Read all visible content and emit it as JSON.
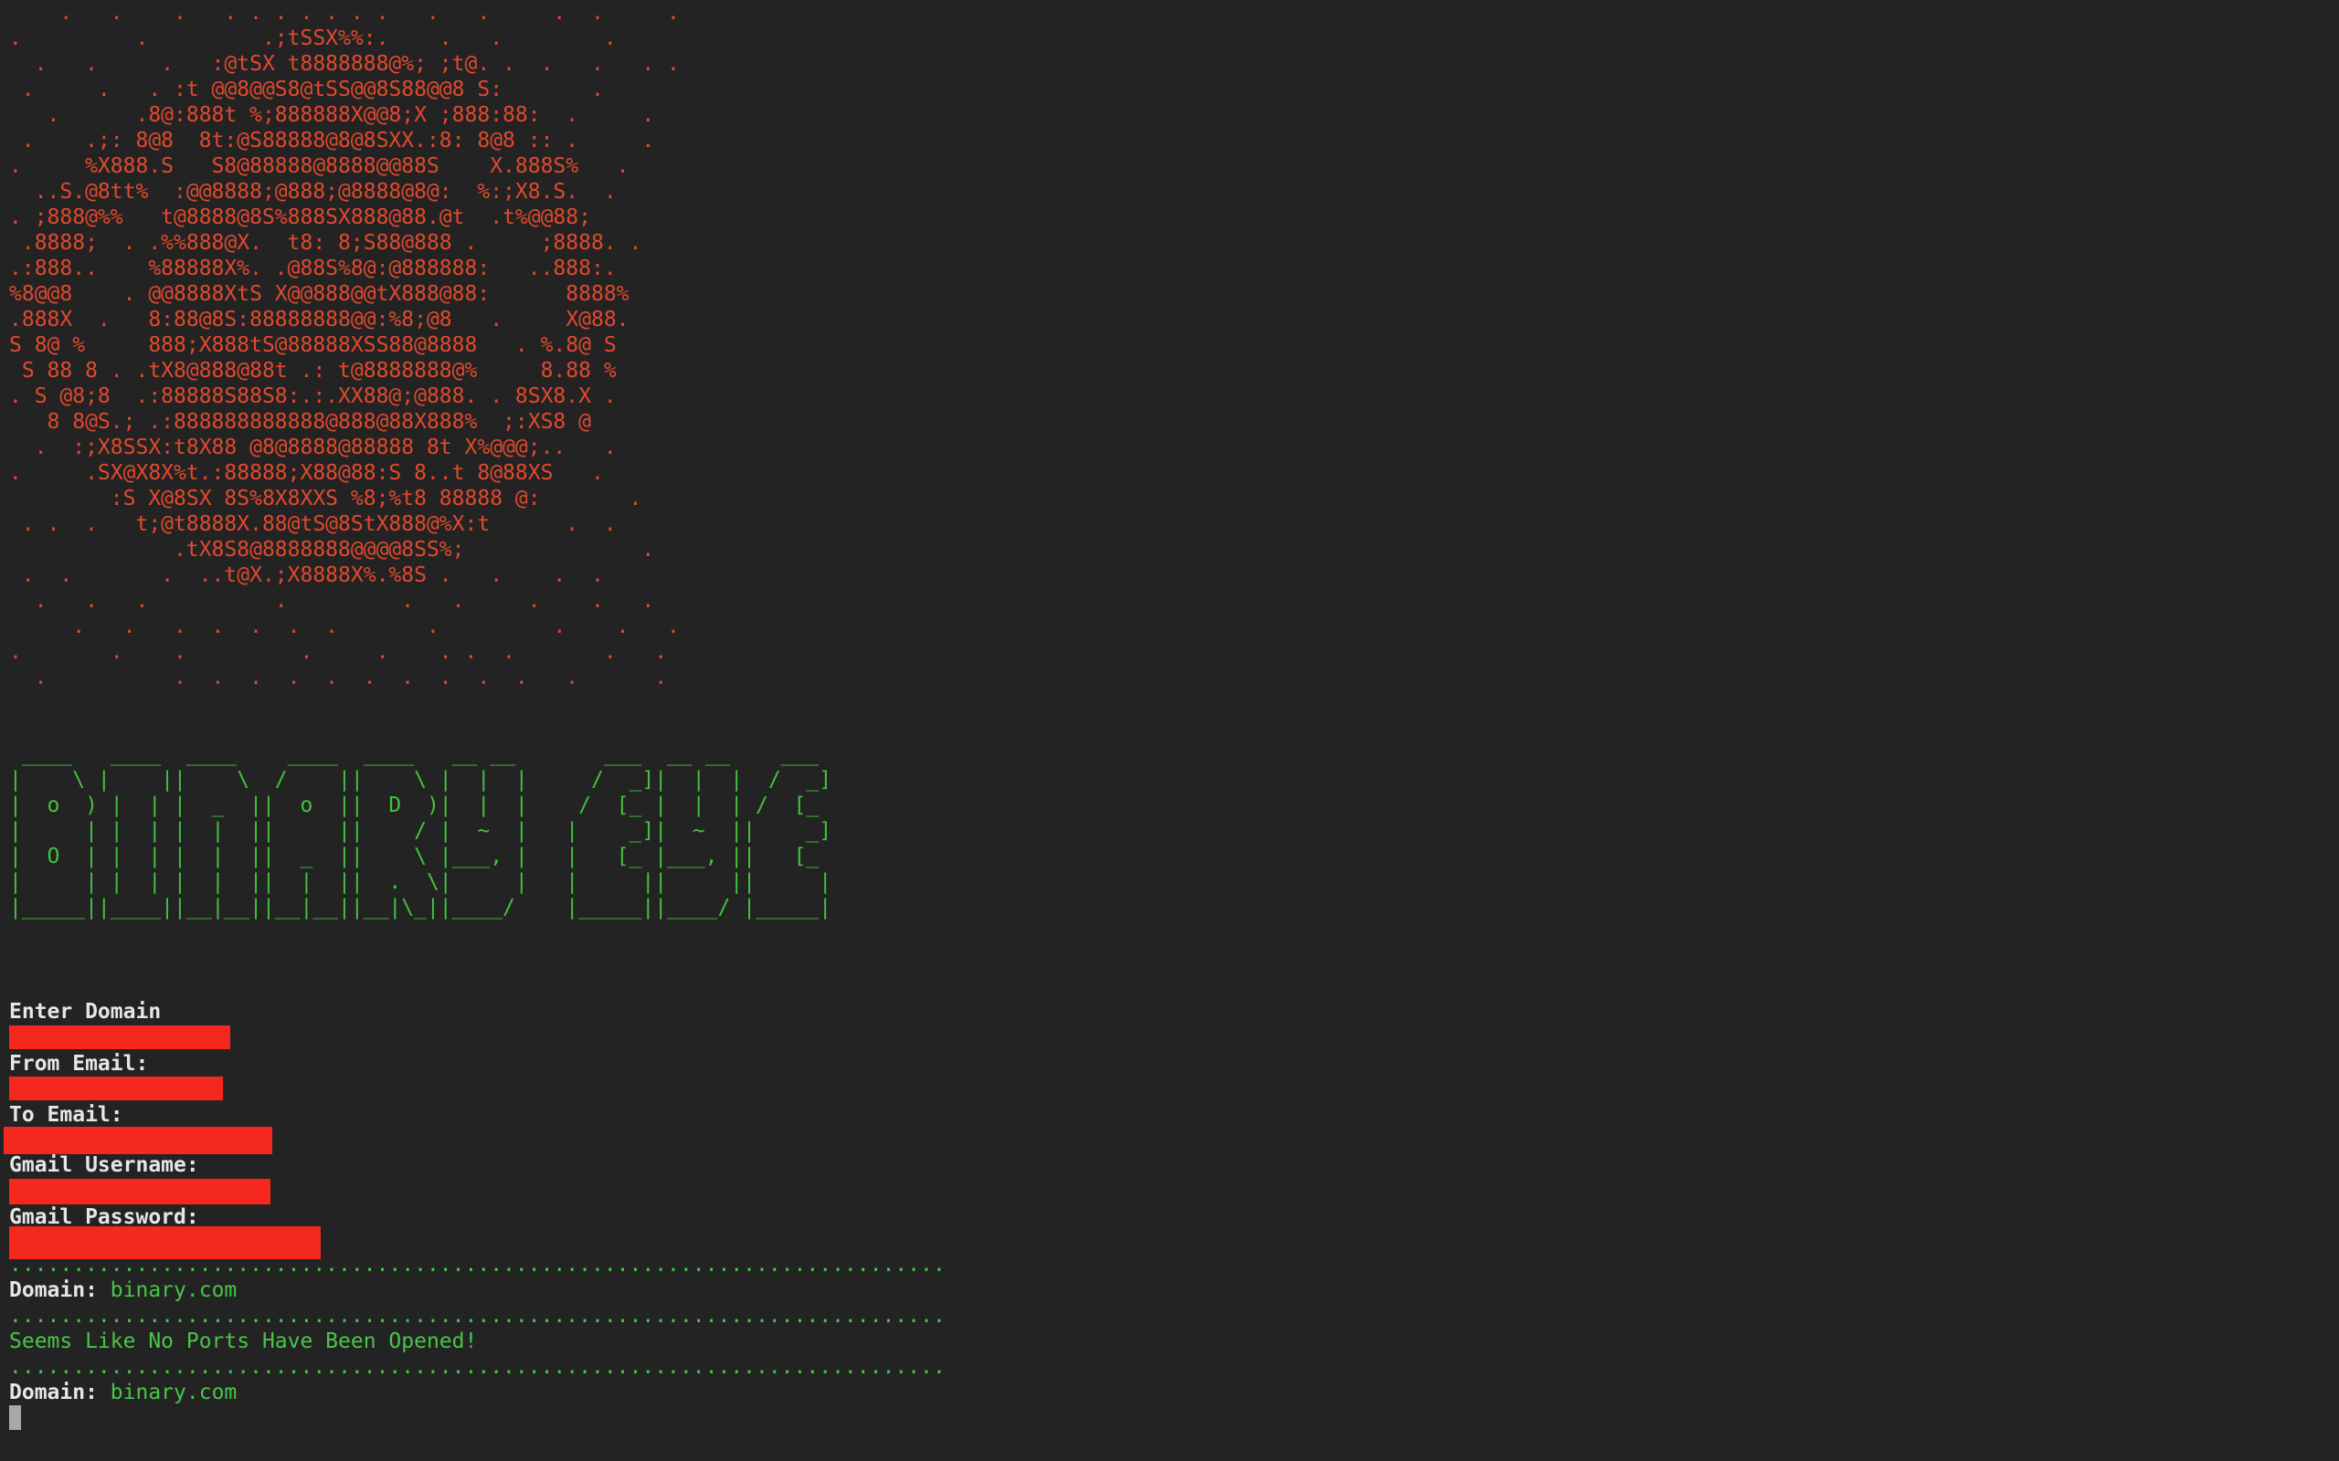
{
  "skull_art": [
    "    .   .    .   . . . . . . .   .   .     .  .     .",
    ".         .         .;tSSX%%:.    .   .        .",
    "  .   .     .   :@tSX t8888888@%; ;t@. .  .   .   . .",
    " .     .   . :t @@8@@S8@tSS@@8S88@@8 S:       .",
    "   .      .8@:888t %;888888X@@8;X ;888:88:  .     .",
    " .    .;: 8@8  8t:@S88888@8@8SXX.:8: 8@8 :: .     .",
    ".     %X888.S   S8@88888@8888@@88S    X.888S%   .",
    "  ..S.@8tt%  :@@8888;@888;@8888@8@:  %:;X8.S.  .",
    ". ;888@%%   t@8888@8S%888SX888@88.@t  .t%@@88;",
    " .8888;  . .%%888@X.  t8: 8;S88@888 .     ;8888. .",
    ".:888..    %88888X%. .@88S%8@:@888888:   ..888:.",
    "%8@@8    . @@8888XtS X@@888@@tX888@88:      8888%",
    ".888X  .   8:88@8S:88888888@@:%8;@8   .     X@88.",
    "S 8@ %     888;X888tS@88888XSS88@8888   . %.8@ S",
    " S 88 8 . .tX8@888@88t .: t@8888888@%     8.88 %",
    ". S @8;8  .:88888S88S8:.:.XX88@;@888. . 8SX8.X .",
    "   8 8@S.; .:888888888888@888@88X888%  ;:XS8 @",
    "  .  :;X8SSX:t8X88 @8@8888@88888 8t X%@@@;..   .",
    ".     .SX@X8X%t.:88888;X88@88:S 8..t 8@88XS   .",
    "        :S X@8SX 8S%8X8XXS %8;%t8 88888 @:       .",
    " . .  .   t;@t8888X.88@tS@8StX888@%X:t      .  .",
    "             .tX8S8@8888888@@@@8SS%;              .",
    " .  .       .  ..t@X.;X8888X%.%8S .   .    .  .",
    "  .   .   .          .         .   .     .    .   .",
    "     .   .   .  .  .  .  .       .         .    .   .",
    ".       .    .         .     .    . .  .       .   .",
    "  .          .  .  .  .  .  .  .  .  .  .   .      ."
  ],
  "banner_art": [
    " ____   ____  ____    ____  ____   __ __       ___  __ __    ___",
    "|    \\ |    ||    \\  /    ||    \\ |  |  |     /  _]|  |  |  /  _]",
    "|  o  ) |  | |  _  ||  o  ||  D  )|  |  |    /  [_ |  |  | /  [_",
    "|     | |  | |  |  ||     ||    / |  ~  |   |    _]|  ~  ||    _]",
    "|  O  | |  | |  |  ||  _  ||    \\ |___, |   |   [_ |___, ||   [_",
    "|     | |  | |  |  ||  |  ||  .  \\|     |   |     ||     ||     |",
    "|_____||____||__|__||__|__||__|\\_||____/    |_____||____/ |_____|"
  ],
  "prompts": {
    "enter_domain": "Enter Domain",
    "from_email": "From Email:",
    "to_email": "To Email:",
    "gmail_username": "Gmail Username:",
    "gmail_password": "Gmail Password:"
  },
  "separator": "..........................................................................",
  "results": {
    "domain_label": "Domain:",
    "domain_value": "binary.com",
    "ports_message": "Seems Like No Ports Have Been Opened!",
    "domain_label_2": "Domain:",
    "domain_value_2": "binary.com"
  },
  "colors": {
    "background": "#232323",
    "skull": "#e2492d",
    "banner": "#42c23e",
    "redaction": "#f5281e"
  }
}
